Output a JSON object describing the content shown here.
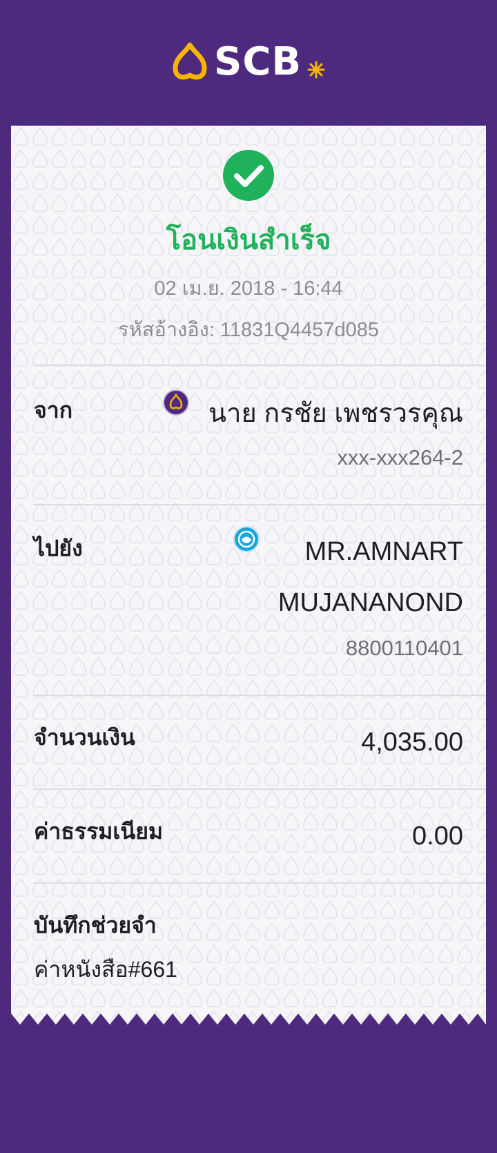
{
  "header": {
    "brand_name": "SCB",
    "logo_icon": "scb-bell-logo-icon",
    "brand_color": "#4e2a7f",
    "accent_color": "#f7b500"
  },
  "receipt": {
    "status_icon": "check-circle-icon",
    "status_color": "#1fb25a",
    "title": "โอนเงินสำเร็จ",
    "datetime": "02 เม.ย. 2018 - 16:44",
    "reference_label": "รหัสอ้างอิง:",
    "reference_value": "11831Q4457d085",
    "from": {
      "label": "จาก",
      "bank_icon": "scb-bank-icon",
      "name": "นาย กรชัย เพชรวรคุณ",
      "account": "xxx-xxx264-2"
    },
    "to": {
      "label": "ไปยัง",
      "bank_icon": "ktb-bank-icon",
      "name_line1": "MR.AMNART",
      "name_line2": "MUJANANOND",
      "account": "8800110401"
    },
    "amount": {
      "label": "จำนวนเงิน",
      "value": "4,035.00"
    },
    "fee": {
      "label": "ค่าธรรมเนียม",
      "value": "0.00"
    },
    "memo": {
      "label": "บันทึกช่วยจำ",
      "value": "ค่าหนังสือ#661"
    }
  }
}
